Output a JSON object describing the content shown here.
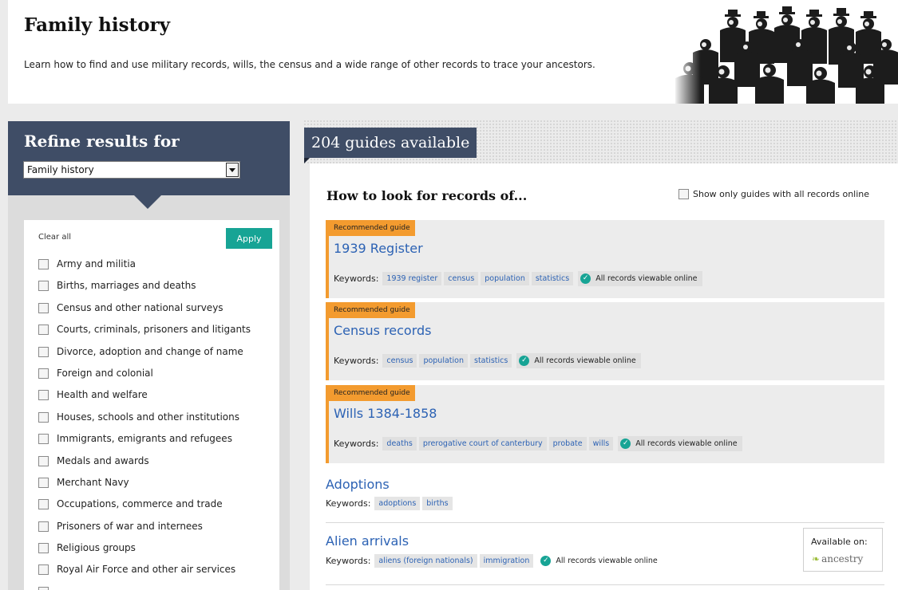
{
  "header": {
    "title": "Family history",
    "intro": "Learn how to find and use military records, wills, the census and a wide range of other records to trace your ancestors."
  },
  "sidebar": {
    "refine_title": "Refine results for",
    "selected_category": "Family history",
    "clear_all": "Clear all",
    "apply": "Apply",
    "filters": [
      "Army and militia",
      "Births, marriages and deaths",
      "Census and other national surveys",
      "Courts, criminals, prisoners and litigants",
      "Divorce, adoption and change of name",
      "Foreign and colonial",
      "Health and welfare",
      "Houses, schools and other institutions",
      "Immigrants, emigrants and refugees",
      "Medals and awards",
      "Merchant Navy",
      "Occupations, commerce and trade",
      "Prisoners of war and internees",
      "Religious groups",
      "Royal Air Force and other air services"
    ]
  },
  "main": {
    "guides_count": "204 guides available",
    "section_title": "How to look for records of...",
    "online_toggle": "Show only guides with all records online",
    "keywords_label": "Keywords:",
    "recommended_tag": "Recommended guide",
    "online_badge": "All records viewable online",
    "recommended": [
      {
        "title": "1939 Register",
        "keywords": [
          "1939 register",
          "census",
          "population",
          "statistics"
        ]
      },
      {
        "title": "Census records",
        "keywords": [
          "census",
          "population",
          "statistics"
        ]
      },
      {
        "title": "Wills 1384-1858",
        "keywords": [
          "deaths",
          "prerogative court of canterbury",
          "probate",
          "wills"
        ]
      }
    ],
    "guides": [
      {
        "title": "Adoptions",
        "keywords": [
          "adoptions",
          "births"
        ]
      },
      {
        "title": "Alien arrivals",
        "keywords": [
          "aliens (foreign nationals)",
          "immigration"
        ]
      }
    ],
    "available_on": "Available on:",
    "partner": "ancestry"
  },
  "colors": {
    "navy": "#3f4d66",
    "teal": "#17a495",
    "orange": "#f39b2f",
    "link": "#2c62b4"
  }
}
